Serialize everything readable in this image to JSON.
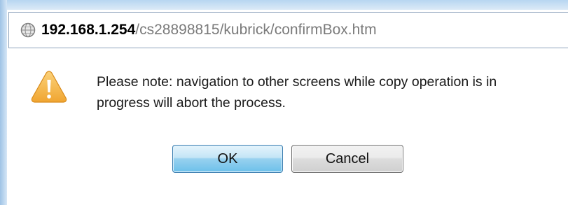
{
  "address_bar": {
    "host": "192.168.1.254",
    "path": "/cs28898815/kubrick/confirmBox.htm",
    "icon": "globe-icon"
  },
  "dialog": {
    "icon": "warning-icon",
    "message": "Please note: navigation to other screens while copy operation is in progress will abort the process.",
    "ok_label": "OK",
    "cancel_label": "Cancel"
  },
  "colors": {
    "warning_fill": "#f5b84a",
    "ok_button": "#9dd3ef",
    "cancel_button": "#e3e3e3"
  }
}
